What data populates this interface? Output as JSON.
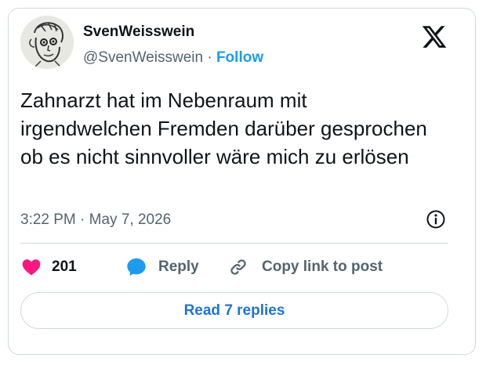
{
  "author": {
    "display_name": "SvenWeisswein",
    "handle": "@SvenWeisswein",
    "separator": " · ",
    "follow_label": "Follow",
    "avatar_icon": "sketch-face-avatar"
  },
  "tweet": {
    "text": "Zahnarzt hat im Nebenraum mit irgendwelchen Fremden darüber gesprochen ob es nicht sinnvoller wäre mich zu erlösen",
    "timestamp": "3:22 PM · May 7, 2026"
  },
  "actions": {
    "like_count": "201",
    "reply_label": "Reply",
    "copy_link_label": "Copy link to post"
  },
  "read_replies_label": "Read 7 replies",
  "colors": {
    "like": "#f91880",
    "reply": "#1d9bf0",
    "follow": "#1d9bf0",
    "muted": "#536471"
  },
  "icons": [
    "x-logo-icon",
    "info-icon",
    "heart-icon",
    "reply-bubble-icon",
    "link-icon"
  ]
}
